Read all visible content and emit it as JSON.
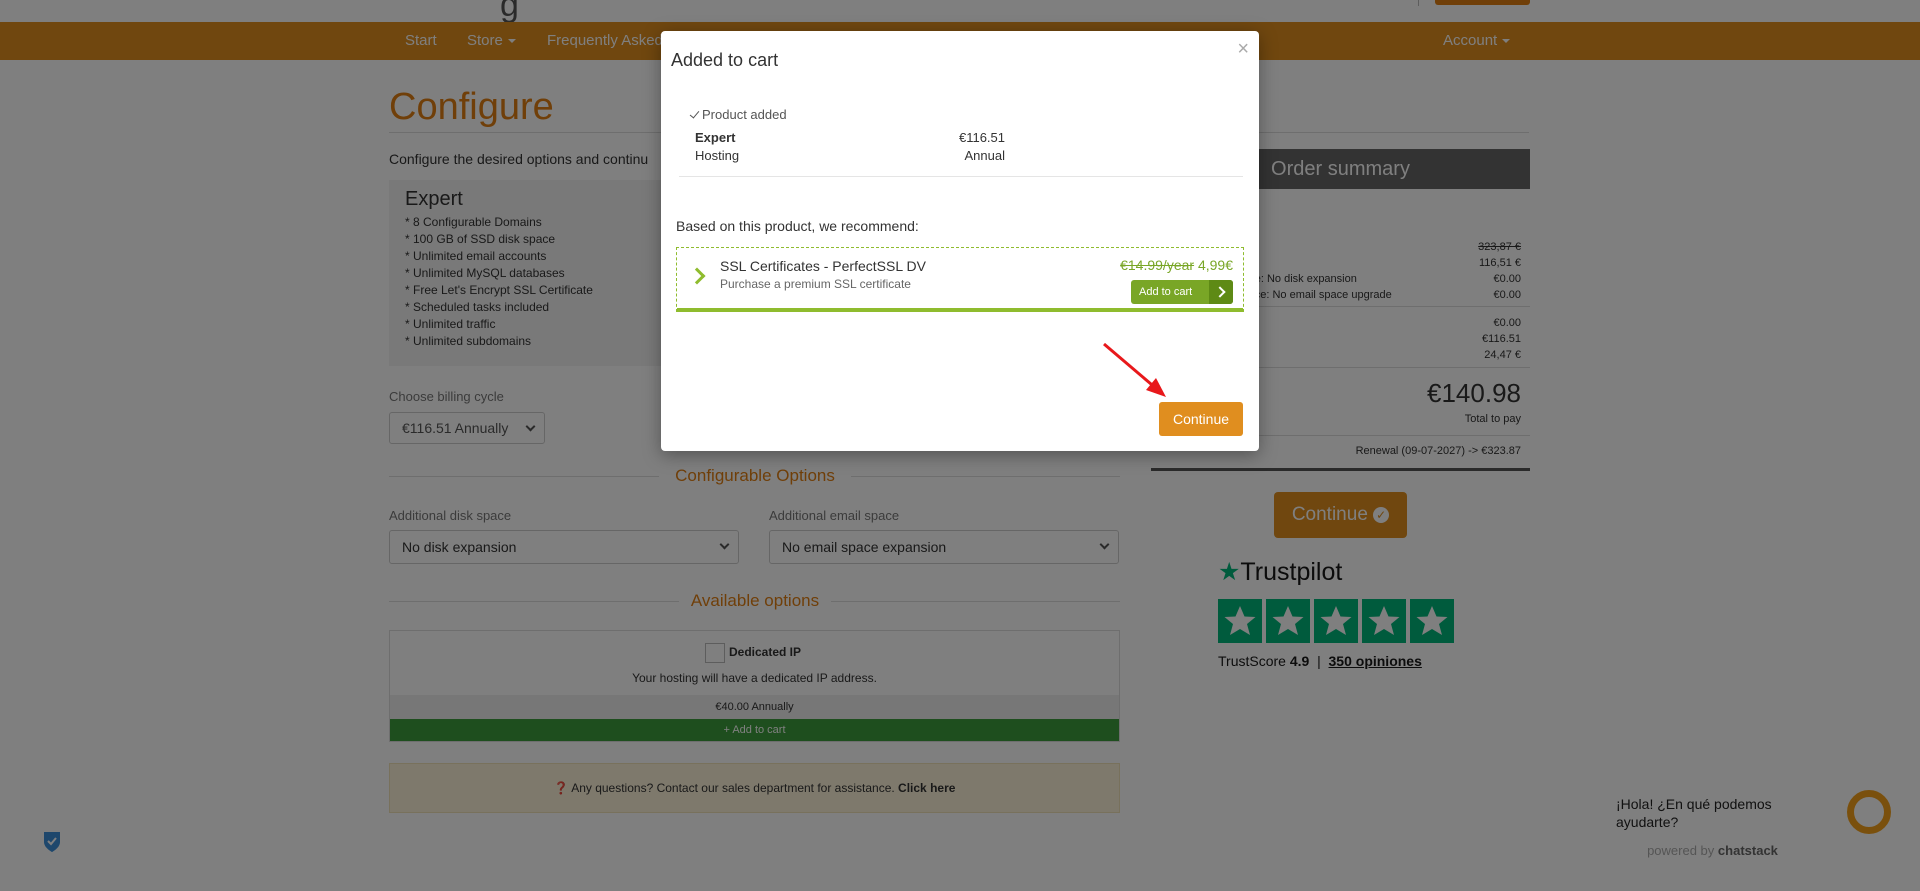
{
  "nav": {
    "items": [
      "Start",
      "Store",
      "Frequently Asked"
    ],
    "account": "Account"
  },
  "page": {
    "title": "Configure",
    "intro": "Configure the desired options and continu"
  },
  "product": {
    "name": "Expert",
    "features": [
      "* 8 Configurable Domains",
      "* 100 GB of SSD disk space",
      "* Unlimited email accounts",
      "* Unlimited MySQL databases",
      "* Free Let's Encrypt SSL Certificate",
      "* Scheduled tasks included",
      "* Unlimited traffic",
      "* Unlimited subdomains"
    ]
  },
  "billing": {
    "label": "Choose billing cycle",
    "value": "€116.51 Annually"
  },
  "configurable": {
    "title": "Configurable Options",
    "disk_label": "Additional disk space",
    "disk_value": "No disk expansion",
    "email_label": "Additional email space",
    "email_value": "No email space expansion"
  },
  "available": {
    "title": "Available options",
    "addon_name": "Dedicated IP",
    "addon_desc": "Your hosting will have a dedicated IP address.",
    "addon_price": "€40.00 Annually",
    "addon_add": "Add to cart"
  },
  "help": {
    "text": "Any questions? Contact our sales department for assistance.",
    "link": "Click here"
  },
  "summary": {
    "title": "Order summary",
    "rows": [
      {
        "label": "",
        "value": "323,87 €"
      },
      {
        "label": "",
        "value": "116,51 €"
      },
      {
        "label": "pace: No disk expansion",
        "value": "€0.00"
      },
      {
        "label": "space: No email space upgrade",
        "value": "€0.00"
      },
      {
        "label": "",
        "value": "€0.00"
      },
      {
        "label": "",
        "value": "€116.51"
      },
      {
        "label": "",
        "value": "24,47 €"
      }
    ],
    "total": "€140.98",
    "total_label": "Total to pay",
    "renewal": "Renewal (09-07-2027) -> €323.87"
  },
  "continue_main": "Continue",
  "trustpilot": {
    "brand": "Trustpilot",
    "score_label": "TrustScore",
    "score": "4.9",
    "reviews": "350 opiniones",
    "rating": 5
  },
  "chat": {
    "message": "¡Hola! ¿En qué podemos ayudarte?",
    "powered_prefix": "powered by",
    "powered_brand": "chatstack"
  },
  "modal": {
    "title": "Added to cart",
    "close": "×",
    "added": "Product added",
    "rows": [
      {
        "label": "Expert",
        "value": "€116.51"
      },
      {
        "label": "Hosting",
        "value": "Annual"
      }
    ],
    "recommend": "Based on this product, we recommend:",
    "rec_name": "SSL Certificates - PerfectSSL DV",
    "rec_desc": "Purchase a premium SSL certificate",
    "rec_old_price": "€14.99/year",
    "rec_new_price": "4,99€",
    "rec_add": "Add to cart",
    "continue": "Continue"
  },
  "colors": {
    "brand_orange": "#e08e1f",
    "accent_green": "#8fbc2e",
    "trustpilot_green": "#00b67a"
  }
}
